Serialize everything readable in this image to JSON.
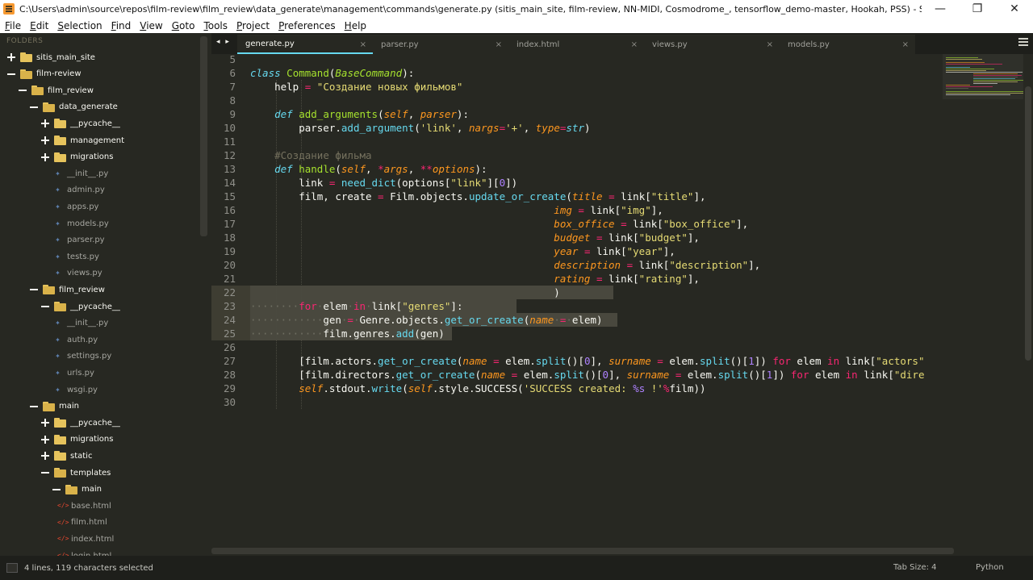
{
  "window": {
    "title": "C:\\Users\\admin\\source\\repos\\film-review\\film_review\\data_generate\\management\\commands\\generate.py (sitis_main_site, film-review, NN-MIDI, Cosmodrome_, tensorflow_demo-master, Hookah, PSS) - Sublime Text",
    "minimize": "—",
    "maximize": "❐",
    "close": "✕"
  },
  "menu": [
    "File",
    "Edit",
    "Selection",
    "Find",
    "View",
    "Goto",
    "Tools",
    "Project",
    "Preferences",
    "Help"
  ],
  "sidebar": {
    "header": "FOLDERS",
    "items": [
      {
        "label": "sitis_main_site",
        "kind": "folder",
        "state": "closed",
        "depth": 0
      },
      {
        "label": "film-review",
        "kind": "folder",
        "state": "open",
        "depth": 0
      },
      {
        "label": "film_review",
        "kind": "folder",
        "state": "open",
        "depth": 1
      },
      {
        "label": "data_generate",
        "kind": "folder",
        "state": "open",
        "depth": 2
      },
      {
        "label": "__pycache__",
        "kind": "folder",
        "state": "closed",
        "depth": 3
      },
      {
        "label": "management",
        "kind": "folder",
        "state": "closed",
        "depth": 3
      },
      {
        "label": "migrations",
        "kind": "folder",
        "state": "closed",
        "depth": 3
      },
      {
        "label": "__init__.py",
        "kind": "py",
        "depth": 3
      },
      {
        "label": "admin.py",
        "kind": "py",
        "depth": 3
      },
      {
        "label": "apps.py",
        "kind": "py",
        "depth": 3
      },
      {
        "label": "models.py",
        "kind": "py",
        "depth": 3
      },
      {
        "label": "parser.py",
        "kind": "py",
        "depth": 3
      },
      {
        "label": "tests.py",
        "kind": "py",
        "depth": 3
      },
      {
        "label": "views.py",
        "kind": "py",
        "depth": 3
      },
      {
        "label": "film_review",
        "kind": "folder",
        "state": "open",
        "depth": 2
      },
      {
        "label": "__pycache__",
        "kind": "folder",
        "state": "open",
        "depth": 3
      },
      {
        "label": "__init__.py",
        "kind": "py",
        "depth": 3
      },
      {
        "label": "auth.py",
        "kind": "py",
        "depth": 3
      },
      {
        "label": "settings.py",
        "kind": "py",
        "depth": 3
      },
      {
        "label": "urls.py",
        "kind": "py",
        "depth": 3
      },
      {
        "label": "wsgi.py",
        "kind": "py",
        "depth": 3
      },
      {
        "label": "main",
        "kind": "folder",
        "state": "open",
        "depth": 2
      },
      {
        "label": "__pycache__",
        "kind": "folder",
        "state": "closed",
        "depth": 3
      },
      {
        "label": "migrations",
        "kind": "folder",
        "state": "closed",
        "depth": 3
      },
      {
        "label": "static",
        "kind": "folder",
        "state": "closed",
        "depth": 3
      },
      {
        "label": "templates",
        "kind": "folder",
        "state": "open",
        "depth": 3
      },
      {
        "label": "main",
        "kind": "folder",
        "state": "open",
        "depth": 4
      },
      {
        "label": "base.html",
        "kind": "html",
        "depth": 5
      },
      {
        "label": "film.html",
        "kind": "html",
        "depth": 5
      },
      {
        "label": "index.html",
        "kind": "html",
        "depth": 5
      },
      {
        "label": "login.html",
        "kind": "html",
        "depth": 5
      }
    ]
  },
  "tabs": {
    "nav": "◂ ▸",
    "items": [
      {
        "label": "generate.py",
        "active": true
      },
      {
        "label": "parser.py",
        "active": false
      },
      {
        "label": "index.html",
        "active": false
      },
      {
        "label": "views.py",
        "active": false
      },
      {
        "label": "models.py",
        "active": false
      }
    ],
    "close_glyph": "×"
  },
  "editor": {
    "lines": [
      {
        "n": "5",
        "html": ""
      },
      {
        "n": "6",
        "html": "<span class='kw'>class</span> <span class='cls'>Command</span>(<span class='inh'>BaseCommand</span>):"
      },
      {
        "n": "7",
        "html": "    help <span class='op'>=</span> <span class='str'>\"Создание новых фильмов\"</span>"
      },
      {
        "n": "8",
        "html": ""
      },
      {
        "n": "9",
        "html": "    <span class='kw'>def</span> <span class='fn'>add_arguments</span>(<span class='par'>self</span>, <span class='par'>parser</span>):"
      },
      {
        "n": "10",
        "html": "        parser.<span class='fnb'>add_argument</span>(<span class='str'>'link'</span>, <span class='par'>nargs</span><span class='op'>=</span><span class='str'>'+'</span>, <span class='par'>type</span><span class='op'>=</span><span class='kw'>str</span>)"
      },
      {
        "n": "11",
        "html": ""
      },
      {
        "n": "12",
        "html": "    <span class='cmt'>#Создание фильма</span>"
      },
      {
        "n": "13",
        "html": "    <span class='kw'>def</span> <span class='fn'>handle</span>(<span class='par'>self</span>, <span class='op'>*</span><span class='par'>args</span>, <span class='op'>**</span><span class='par'>options</span>):"
      },
      {
        "n": "14",
        "html": "        link <span class='op'>=</span> <span class='fnb'>need_dict</span>(options[<span class='str'>\"link\"</span>][<span class='num'>0</span>])"
      },
      {
        "n": "15",
        "html": "        film, create <span class='op'>=</span> Film.objects.<span class='fnb'>update_or_create</span>(<span class='par'>title</span> <span class='op'>=</span> link[<span class='str'>\"title\"</span>],"
      },
      {
        "n": "16",
        "html": "                                                  <span class='par'>img</span> <span class='op'>=</span> link[<span class='str'>\"img\"</span>],"
      },
      {
        "n": "17",
        "html": "                                                  <span class='par'>box_office</span> <span class='op'>=</span> link[<span class='str'>\"box_office\"</span>],"
      },
      {
        "n": "18",
        "html": "                                                  <span class='par'>budget</span> <span class='op'>=</span> link[<span class='str'>\"budget\"</span>],"
      },
      {
        "n": "19",
        "html": "                                                  <span class='par'>year</span> <span class='op'>=</span> link[<span class='str'>\"year\"</span>],"
      },
      {
        "n": "20",
        "html": "                                                  <span class='par'>description</span> <span class='op'>=</span> link[<span class='str'>\"description\"</span>],"
      },
      {
        "n": "21",
        "html": "                                                  <span class='par'>rating</span> <span class='op'>=</span> link[<span class='str'>\"rating\"</span>],"
      },
      {
        "n": "22",
        "html": "<span class='dots'>                                                </span>  )"
      },
      {
        "n": "23",
        "html": "<span class='dots'>········</span><span class='op'>for</span><span class='dots'>·</span>elem<span class='dots'>·</span><span class='op'>in</span><span class='dots'>·</span>link[<span class='str'>\"genres\"</span>]:"
      },
      {
        "n": "24",
        "html": "<span class='dots'>············</span>gen<span class='dots'>·</span><span class='op'>=</span><span class='dots'>·</span>Genre.objects.<span class='fnb'>get_or_create</span>(<span class='par'>name</span><span class='dots'>·</span><span class='op'>=</span><span class='dots'>·</span>elem)"
      },
      {
        "n": "25",
        "html": "<span class='dots'>············</span>film.genres.<span class='fnb'>add</span>(gen)"
      },
      {
        "n": "26",
        "html": ""
      },
      {
        "n": "27",
        "html": "        [film.actors.<span class='fnb'>get_or_create</span>(<span class='par'>name</span> <span class='op'>=</span> elem.<span class='fnb'>split</span>()[<span class='num'>0</span>], <span class='par'>surname</span> <span class='op'>=</span> elem.<span class='fnb'>split</span>()[<span class='num'>1</span>]) <span class='op'>for</span> elem <span class='op'>in</span> link[<span class='str'>\"actors\"</span>"
      },
      {
        "n": "28",
        "html": "        [film.directors.<span class='fnb'>get_or_create</span>(<span class='par'>name</span> <span class='op'>=</span> elem.<span class='fnb'>split</span>()[<span class='num'>0</span>], <span class='par'>surname</span> <span class='op'>=</span> elem.<span class='fnb'>split</span>()[<span class='num'>1</span>]) <span class='op'>for</span> elem <span class='op'>in</span> link[<span class='str'>\"dire</span>"
      },
      {
        "n": "29",
        "html": "        <span class='self'>self</span>.stdout.<span class='fnb'>write</span>(<span class='self'>self</span>.style.SUCCESS(<span class='str'>'SUCCESS created: </span><span class='num'>%s</span><span class='str'> !'</span><span class='op'>%</span>film))"
      },
      {
        "n": "30",
        "html": ""
      }
    ]
  },
  "status": {
    "selection": "4 lines, 119 characters selected",
    "tab_size": "Tab Size: 4",
    "syntax": "Python"
  },
  "colors": {
    "background": "#272822",
    "keyword": "#66d9ef",
    "string": "#e6db74",
    "operator": "#f92672",
    "function": "#a6e22e",
    "parameter": "#fd971f",
    "number": "#ae81ff",
    "comment": "#75715e",
    "tab_active_underline": "#66d9ef"
  }
}
